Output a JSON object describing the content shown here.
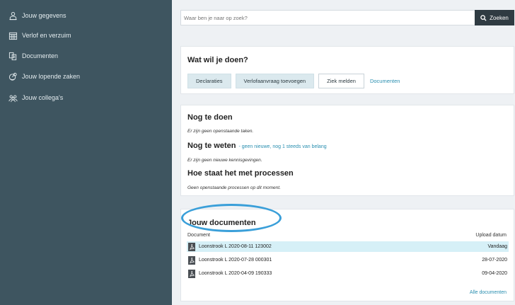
{
  "sidebar": {
    "items": [
      {
        "label": "Jouw gegevens",
        "icon": "person-icon"
      },
      {
        "label": "Verlof en verzuim",
        "icon": "calendar-icon"
      },
      {
        "label": "Documenten",
        "icon": "documents-icon"
      },
      {
        "label": "Jouw lopende zaken",
        "icon": "cases-icon"
      },
      {
        "label": "Jouw collega's",
        "icon": "colleagues-icon"
      }
    ]
  },
  "search": {
    "placeholder": "Waar ben je naar op zoek?",
    "button_label": "Zoeken"
  },
  "actions": {
    "title": "Wat wil je doen?",
    "buttons": [
      "Declaraties",
      "Verlofaanvraag toevoegen",
      "Ziek melden"
    ],
    "link": "Documenten"
  },
  "status": {
    "todo_title": "Nog te doen",
    "todo_note": "Er zijn geen openstaande taken.",
    "know_title": "Nog te weten",
    "know_link": "- geen nieuwe, nog 1 steeds van belang",
    "know_note": "Er zijn geen nieuwe kennisgevingen.",
    "process_title": "Hoe staat het met processen",
    "process_note": "Geen openstaande processen op dit moment."
  },
  "documents": {
    "title": "Jouw documenten",
    "col_document": "Document",
    "col_date": "Upload datum",
    "rows": [
      {
        "name": "Loonstrook L 2020-08-11 123002",
        "date": "Vandaag"
      },
      {
        "name": "Loonstrook L 2020-07-28 000301",
        "date": "28-07-2020"
      },
      {
        "name": "Loonstrook L 2020-04-09 190333",
        "date": "09-04-2020"
      }
    ],
    "all_link": "Alle documenten"
  },
  "colors": {
    "sidebar_bg": "#3e5560",
    "accent_link": "#2a8fb0",
    "highlight_ring": "#3a9fd9",
    "selected_row": "#d6f0f7"
  }
}
